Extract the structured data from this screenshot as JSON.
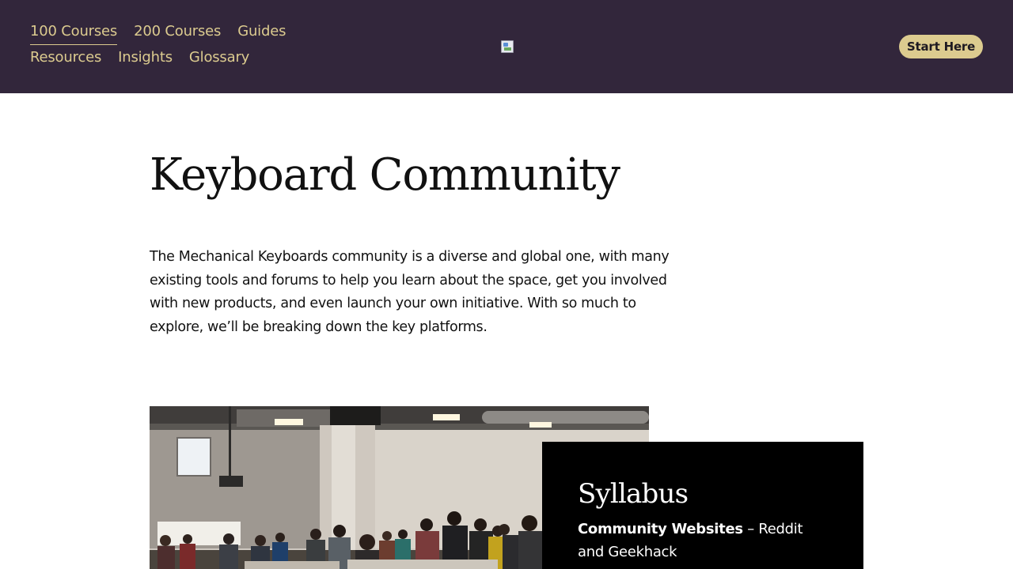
{
  "nav": {
    "items": [
      {
        "label": "100 Courses",
        "active": true
      },
      {
        "label": "200 Courses"
      },
      {
        "label": "Guides"
      },
      {
        "label": "Resources"
      },
      {
        "label": "Insights"
      },
      {
        "label": "Glossary"
      }
    ]
  },
  "header": {
    "logo_icon": "broken-image-icon",
    "cta_label": "Start Here"
  },
  "main": {
    "title": "Keyboard Community",
    "intro": "The Mechanical Keyboards community is a diverse and global one, with many existing tools and forums to help you learn about the space, get you involved with new products, and even launch your own initiative. With so much to explore, we’ll be breaking down the key platforms."
  },
  "syllabus": {
    "heading": "Syllabus",
    "item_strong": "Community Websites",
    "item_rest": " – Reddit and Geekhack"
  },
  "colors": {
    "header_bg": "#32263b",
    "accent": "#dccb8f",
    "panel_bg": "#000000"
  }
}
